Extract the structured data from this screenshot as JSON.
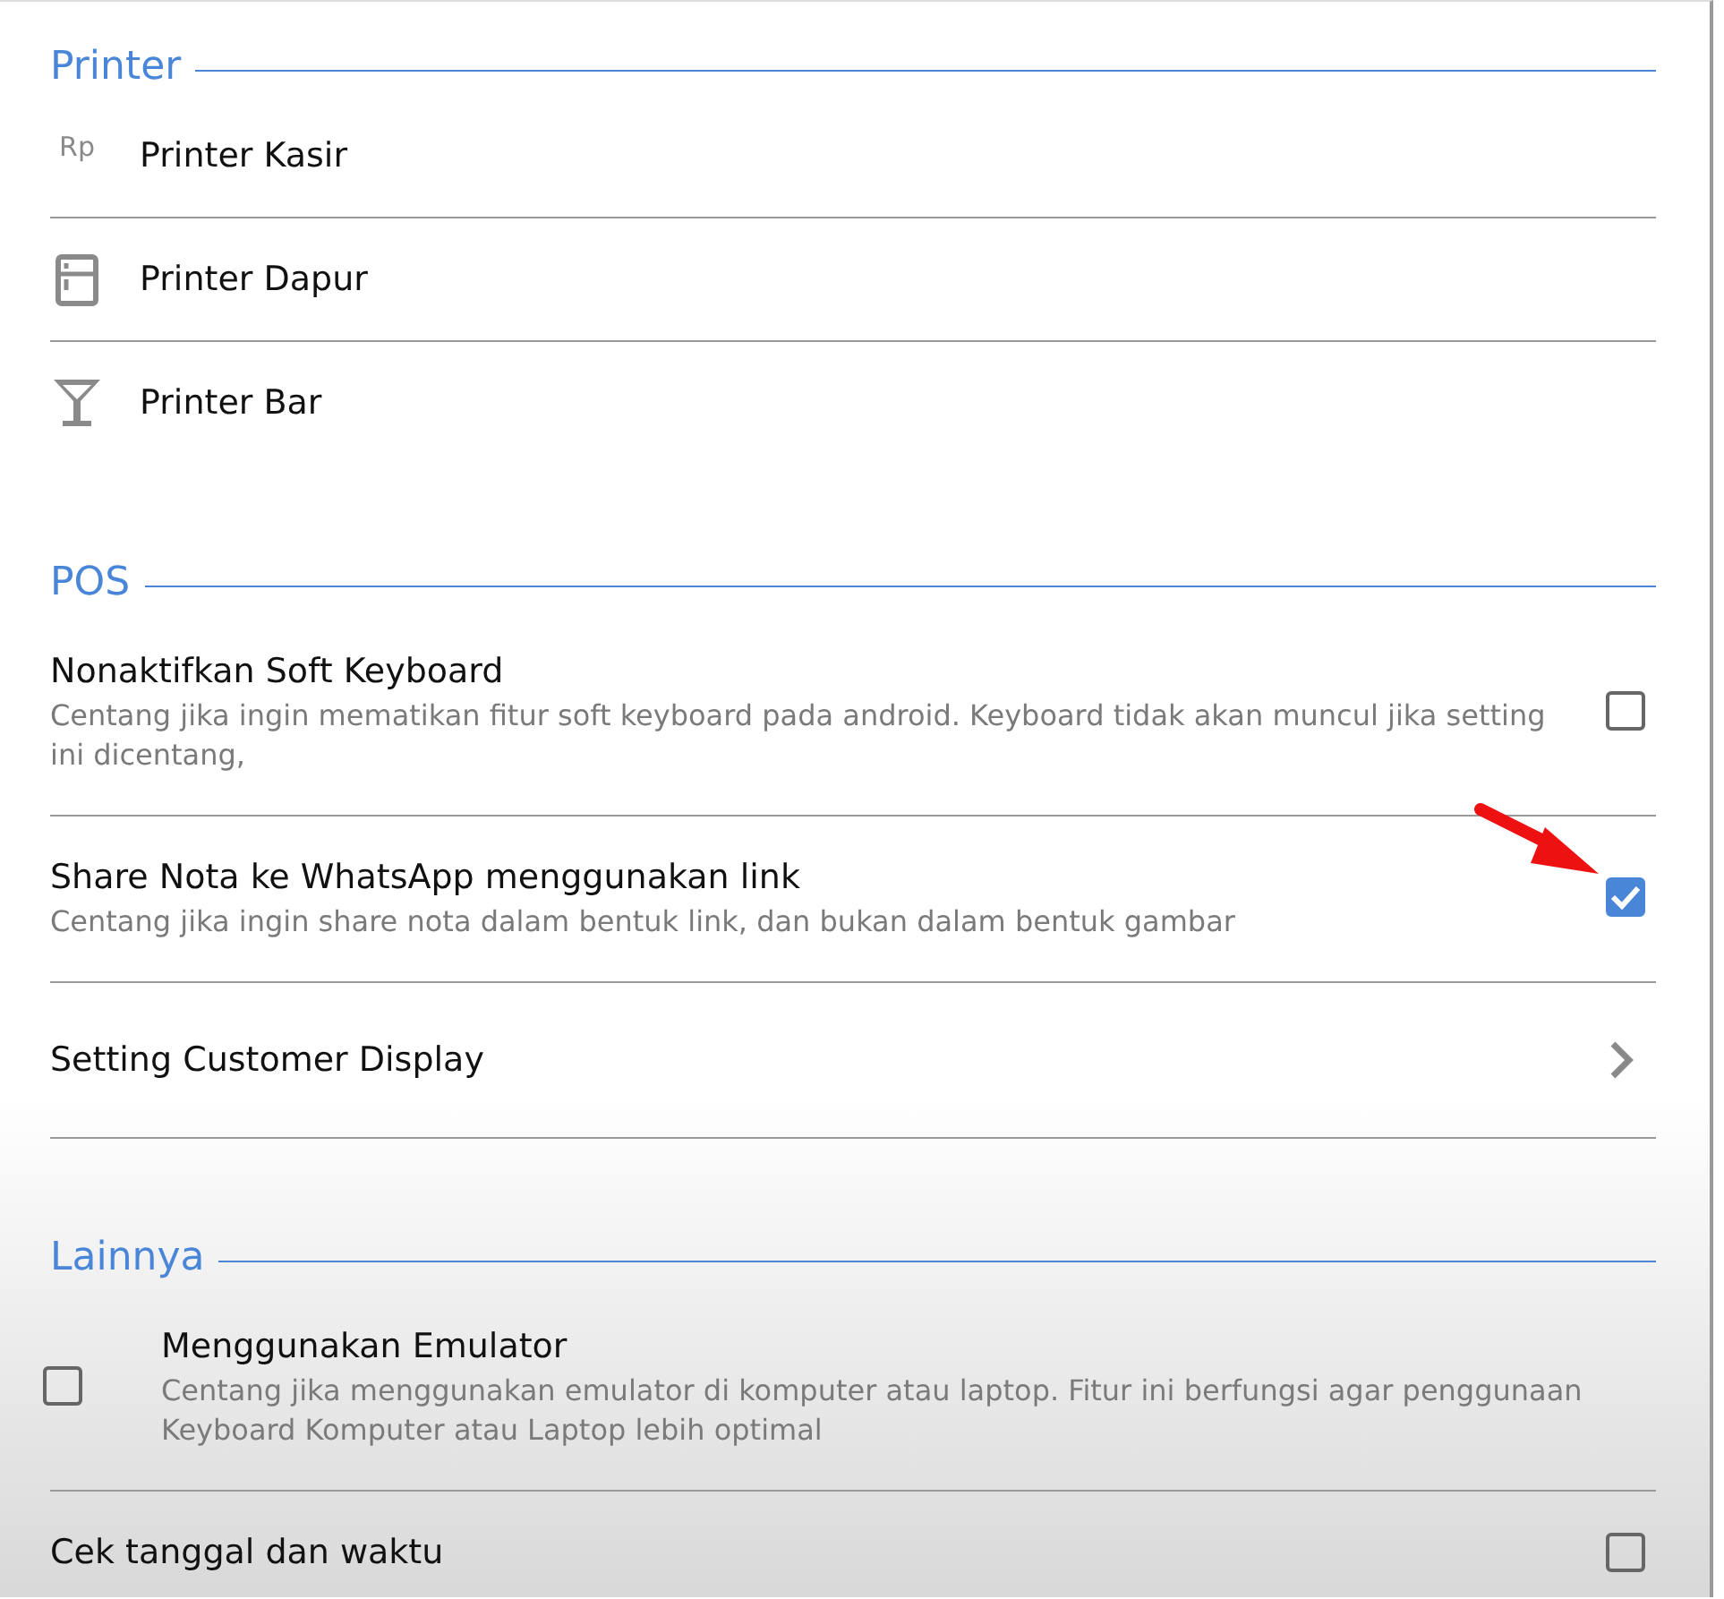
{
  "sections": [
    {
      "title": "Printer",
      "items": [
        {
          "kind": "printer",
          "icon_text": "Rp",
          "title": "Printer Kasir"
        },
        {
          "kind": "printer",
          "title": "Printer Dapur"
        },
        {
          "kind": "printer",
          "title": "Printer Bar"
        }
      ]
    },
    {
      "title": "POS",
      "items": [
        {
          "kind": "checkbox",
          "title": "Nonaktifkan Soft Keyboard",
          "description": "Centang jika ingin mematikan fitur soft keyboard pada android. Keyboard tidak akan muncul jika setting ini dicentang,",
          "checked": false
        },
        {
          "kind": "checkbox",
          "title": "Share Nota ke WhatsApp menggunakan link",
          "description": "Centang jika ingin share nota dalam bentuk link, dan bukan dalam bentuk gambar",
          "checked": true,
          "annotated": true
        },
        {
          "kind": "nav",
          "title": "Setting Customer Display"
        }
      ]
    },
    {
      "title": "Lainnya",
      "items": [
        {
          "kind": "checkbox_left",
          "title": "Menggunakan Emulator",
          "description": "Centang jika menggunakan emulator di komputer atau laptop. Fitur ini berfungsi agar penggunaan Keyboard Komputer atau Laptop lebih optimal",
          "checked": false
        },
        {
          "kind": "checkbox",
          "title": "Cek tanggal dan waktu",
          "checked": false
        }
      ]
    }
  ]
}
